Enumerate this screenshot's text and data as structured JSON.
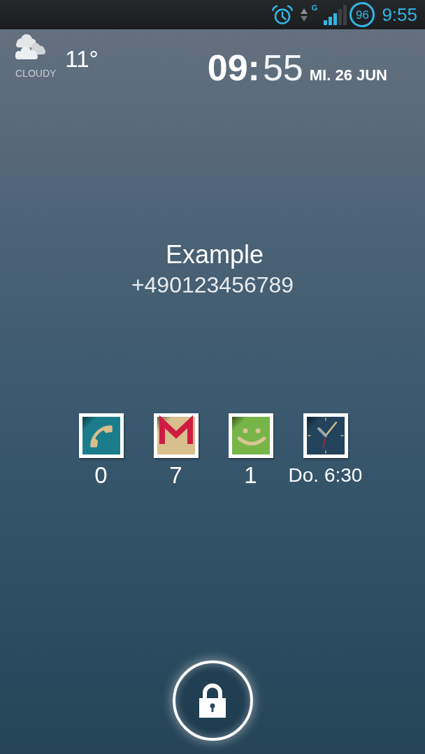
{
  "status_bar": {
    "network_type": "G",
    "battery": "96",
    "time": "9:55"
  },
  "weather": {
    "temperature": "11°",
    "condition": "CLOUDY"
  },
  "clock": {
    "hours": "09:",
    "minutes": "55",
    "date": "MI. 26 JUN"
  },
  "caller": {
    "name": "Example",
    "phone": "+490123456789"
  },
  "notifications": [
    {
      "kind": "phone",
      "label": "0"
    },
    {
      "kind": "mail",
      "label": "7"
    },
    {
      "kind": "chat",
      "label": "1"
    },
    {
      "kind": "alarm",
      "label": "Do. 6:30"
    }
  ]
}
